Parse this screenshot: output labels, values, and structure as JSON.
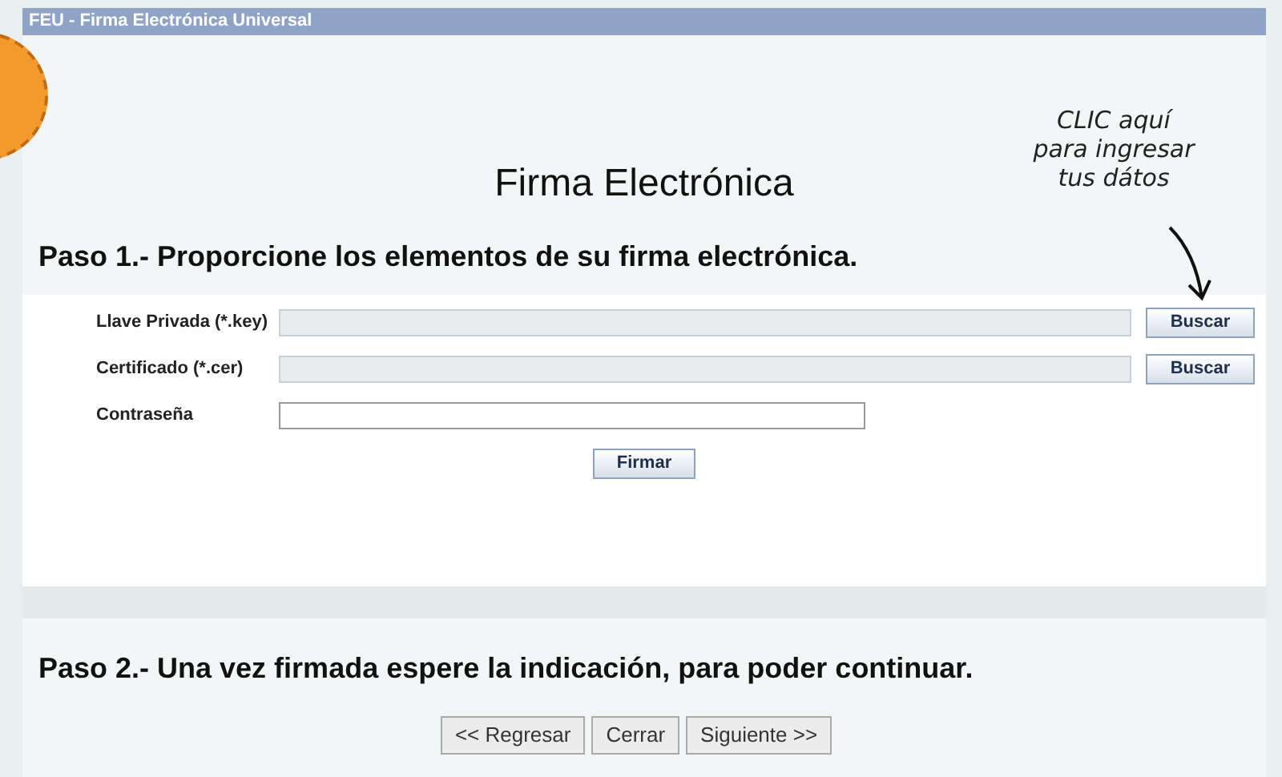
{
  "window": {
    "title": "FEU - Firma Electrónica Universal"
  },
  "heading": "Firma Electrónica",
  "annotation": {
    "lines": [
      "CLIC aquí",
      "para ingresar",
      "tus dátos"
    ]
  },
  "step1": {
    "title": "Paso 1.- Proporcione los elementos de su firma electrónica.",
    "fields": [
      {
        "label": "Llave Privada (*.key)",
        "disabled": true,
        "button": "Buscar"
      },
      {
        "label": "Certificado (*.cer)",
        "disabled": true,
        "button": "Buscar"
      },
      {
        "label": "Contraseña",
        "disabled": false
      }
    ],
    "sign_button": "Firmar"
  },
  "step2": {
    "title": "Paso 2.- Una vez firmada espere la indicación, para poder continuar."
  },
  "buttons": [
    "<< Regresar",
    "Cerrar",
    "Siguiente >>"
  ]
}
